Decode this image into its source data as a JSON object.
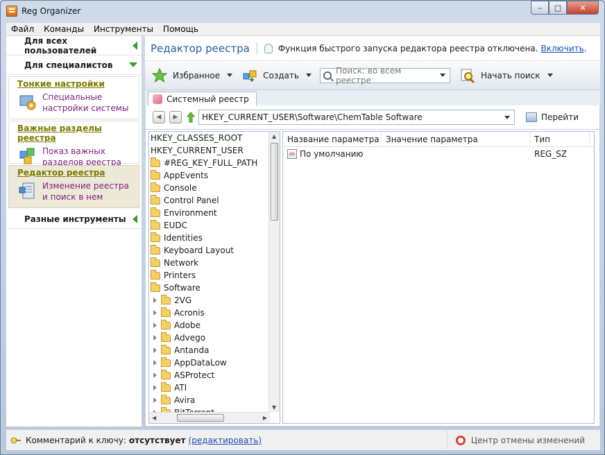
{
  "window": {
    "title": "Reg Organizer",
    "buttons": {
      "min": "–",
      "max": "□",
      "close": "✕"
    }
  },
  "menu": [
    "Файл",
    "Команды",
    "Инструменты",
    "Помощь"
  ],
  "sidebar": {
    "all_users": "Для всех пользователей",
    "specialists": "Для специалистов",
    "cards": [
      {
        "title": "Тонкие настройки",
        "text": "Специальные настройки системы"
      },
      {
        "title": "Важные разделы реестра",
        "text": "Показ важных разделов реестра"
      },
      {
        "title": "Редактор реестра",
        "text": "Изменение реестра и поиск в нем"
      }
    ],
    "misc_tools": "Разные инструменты"
  },
  "header": {
    "title": "Редактор реестра",
    "notice": "Функция быстрого запуска редактора реестра отключена.",
    "enable_link": "Включить"
  },
  "toolbar": {
    "favorites": "Избранное",
    "create": "Создать",
    "search_placeholder": "Поиск: во всем реестре",
    "start_search": "Начать поиск"
  },
  "tab": {
    "label": "Системный реестр"
  },
  "nav": {
    "path": "HKEY_CURRENT_USER\\Software\\ChemTable Software",
    "go": "Перейти"
  },
  "tree": {
    "roots": [
      "HKEY_CLASSES_ROOT",
      "HKEY_CURRENT_USER"
    ],
    "level1": [
      "#REG_KEY_FULL_PATH",
      "AppEvents",
      "Console",
      "Control Panel",
      "Environment",
      "EUDC",
      "Identities",
      "Keyboard Layout",
      "Network",
      "Printers",
      "Software"
    ],
    "level2": [
      "2VG",
      "Acronis",
      "Adobe",
      "Advego",
      "Antanda",
      "AppDataLow",
      "ASProtect",
      "ATI",
      "Avira",
      "BitTorrent"
    ]
  },
  "list": {
    "columns": [
      "Название параметра",
      "Значение параметра",
      "Тип"
    ],
    "rows": [
      {
        "name": "По умолчанию",
        "value": "",
        "type": "REG_SZ",
        "icon": "ab"
      }
    ]
  },
  "status": {
    "comment_label": "Комментарий к ключу:",
    "comment_value": "отсутствует",
    "edit_link": "(редактировать)",
    "undo_center": "Центр отмены изменений"
  },
  "colors": {
    "accent": "#2a5a9a",
    "card_title": "#7a7a00",
    "card_text": "#7a1f7a",
    "link": "#1a4fb5"
  }
}
